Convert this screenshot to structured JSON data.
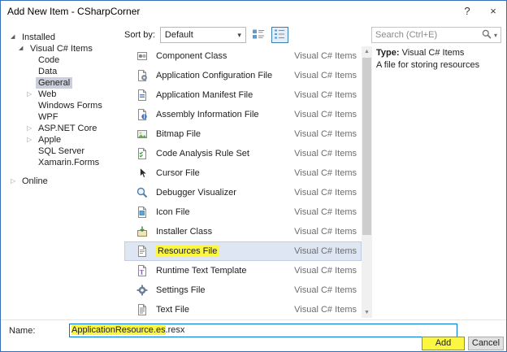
{
  "window": {
    "title": "Add New Item - CSharpCorner",
    "help_glyph": "?",
    "close_glyph": "×"
  },
  "toolbar": {
    "sort_label": "Sort by:",
    "sort_value": "Default",
    "search_placeholder": "Search (Ctrl+E)"
  },
  "sidebar": {
    "nodes": [
      {
        "label": "Installed",
        "level": 0,
        "state": "expanded"
      },
      {
        "label": "Visual C# Items",
        "level": 1,
        "state": "expanded"
      },
      {
        "label": "Code",
        "level": 2,
        "state": "none"
      },
      {
        "label": "Data",
        "level": 2,
        "state": "none"
      },
      {
        "label": "General",
        "level": 2,
        "state": "none",
        "selected": true
      },
      {
        "label": "Web",
        "level": 2,
        "state": "collapsed"
      },
      {
        "label": "Windows Forms",
        "level": 2,
        "state": "none"
      },
      {
        "label": "WPF",
        "level": 2,
        "state": "none"
      },
      {
        "label": "ASP.NET Core",
        "level": 2,
        "state": "collapsed"
      },
      {
        "label": "Apple",
        "level": 2,
        "state": "collapsed"
      },
      {
        "label": "SQL Server",
        "level": 2,
        "state": "none"
      },
      {
        "label": "Xamarin.Forms",
        "level": 2,
        "state": "none"
      },
      {
        "label": "Online",
        "level": 0,
        "state": "collapsed",
        "gap_before": true
      }
    ]
  },
  "templates": {
    "items": [
      {
        "label": "Component Class",
        "group": "Visual C# Items",
        "icon": "component-class-icon"
      },
      {
        "label": "Application Configuration File",
        "group": "Visual C# Items",
        "icon": "application-config-icon"
      },
      {
        "label": "Application Manifest File",
        "group": "Visual C# Items",
        "icon": "application-manifest-icon"
      },
      {
        "label": "Assembly Information File",
        "group": "Visual C# Items",
        "icon": "assembly-information-icon"
      },
      {
        "label": "Bitmap File",
        "group": "Visual C# Items",
        "icon": "bitmap-file-icon"
      },
      {
        "label": "Code Analysis Rule Set",
        "group": "Visual C# Items",
        "icon": "code-analysis-rule-set-icon"
      },
      {
        "label": "Cursor File",
        "group": "Visual C# Items",
        "icon": "cursor-file-icon"
      },
      {
        "label": "Debugger Visualizer",
        "group": "Visual C# Items",
        "icon": "debugger-visualizer-icon"
      },
      {
        "label": "Icon File",
        "group": "Visual C# Items",
        "icon": "icon-file-icon"
      },
      {
        "label": "Installer Class",
        "group": "Visual C# Items",
        "icon": "installer-class-icon"
      },
      {
        "label": "Resources File",
        "group": "Visual C# Items",
        "icon": "resources-file-icon",
        "selected": true,
        "highlighted": true
      },
      {
        "label": "Runtime Text Template",
        "group": "Visual C# Items",
        "icon": "runtime-text-template-icon"
      },
      {
        "label": "Settings File",
        "group": "Visual C# Items",
        "icon": "settings-file-icon"
      },
      {
        "label": "Text File",
        "group": "Visual C# Items",
        "icon": "text-file-icon"
      }
    ]
  },
  "details": {
    "type_label": "Type:",
    "type_value": "Visual C# Items",
    "description": "A file for storing resources"
  },
  "footer": {
    "name_label": "Name:",
    "name_value": "ApplicationResource.es.resx",
    "name_value_highlighted": "ApplicationResource.es",
    "add_label": "Add",
    "cancel_label": "Cancel"
  },
  "colors": {
    "window_border": "#3b6fb5",
    "annotation_highlight": "#fbf63f",
    "tree_selection": "#cccedb",
    "list_selection": "#dde6f2",
    "group_text": "#6d6d6d",
    "focus_input_border": "#0078d7"
  }
}
